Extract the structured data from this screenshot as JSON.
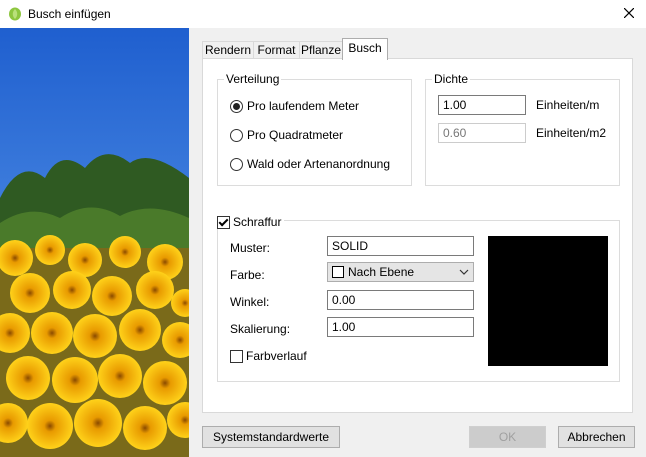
{
  "window": {
    "title": "Busch einfügen",
    "icon": "plant-leaf-icon",
    "close_icon": "close-icon"
  },
  "tabs": [
    {
      "label": "Rendern",
      "active": false
    },
    {
      "label": "Format",
      "active": false
    },
    {
      "label": "Pflanze",
      "active": false
    },
    {
      "label": "Busch",
      "active": true
    }
  ],
  "verteilung": {
    "title": "Verteilung",
    "options": [
      {
        "label": "Pro laufendem Meter",
        "checked": true
      },
      {
        "label": "Pro Quadratmeter",
        "checked": false
      },
      {
        "label": "Wald oder Artenanordnung",
        "checked": false
      }
    ]
  },
  "dichte": {
    "title": "Dichte",
    "meter_value": "1.00",
    "meter_unit": "Einheiten/m",
    "square_value": "0.60",
    "square_unit": "Einheiten/m2"
  },
  "schraffur": {
    "label": "Schraffur",
    "checked": true,
    "muster_label": "Muster:",
    "muster_value": "SOLID",
    "farbe_label": "Farbe:",
    "farbe_value": "Nach Ebene",
    "winkel_label": "Winkel:",
    "winkel_value": "0.00",
    "skalierung_label": "Skalierung:",
    "skalierung_value": "1.00",
    "farbverlauf_label": "Farbverlauf",
    "farbverlauf_checked": false,
    "preview_color": "#000000"
  },
  "buttons": {
    "defaults": "Systemstandardwerte",
    "ok": "OK",
    "cancel": "Abbrechen"
  }
}
